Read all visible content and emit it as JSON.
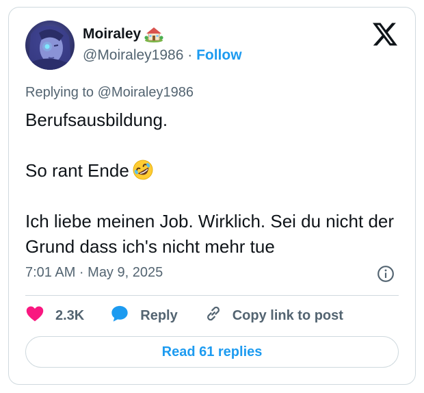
{
  "author": {
    "display_name": "Moiraley",
    "name_badge": "house-with-garden-emoji",
    "handle": "@Moiraley1986",
    "separator": " · ",
    "follow_label": "Follow"
  },
  "brand_icon": "x-logo",
  "tweet": {
    "replying_to": "Replying to @Moiraley1986",
    "line1": "Berufsausbildung.",
    "line2": "So rant Ende",
    "line2_emoji": "rolling-on-floor-laughing-emoji",
    "line3": "Ich liebe meinen Job. Wirklich. Sei du nicht der Grund dass ich's nicht mehr tue",
    "timestamp": "7:01 AM · May 9, 2025"
  },
  "actions": {
    "likes": "2.3K",
    "reply_label": "Reply",
    "copy_link_label": "Copy link to post"
  },
  "read_replies_label": "Read 61 replies",
  "colors": {
    "accent": "#1d9bf0",
    "heart": "#f91880",
    "text_primary": "#0f1419",
    "text_secondary": "#536471",
    "border": "#cfd9de"
  }
}
